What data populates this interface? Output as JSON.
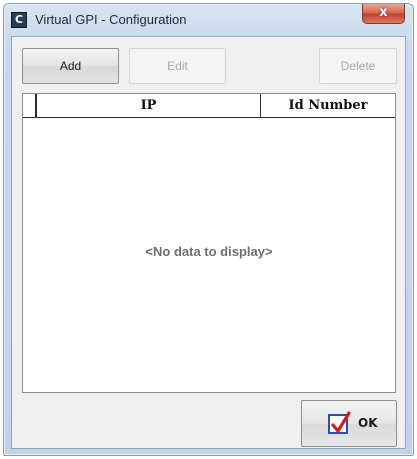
{
  "window": {
    "title": "Virtual GPI - Configuration",
    "app_icon_letter": "C",
    "close_glyph": "x"
  },
  "toolbar": {
    "add_label": "Add",
    "edit_label": "Edit",
    "delete_label": "Delete",
    "edit_enabled": false,
    "delete_enabled": false
  },
  "grid": {
    "columns": [
      "IP",
      "Id Number"
    ],
    "rows": [],
    "empty_message": "<No data to display>"
  },
  "footer": {
    "ok_label": "OK",
    "ok_icon": "checkbox-checked-icon"
  },
  "colors": {
    "close_button": "#c2402a",
    "ok_check": "#d01c1c",
    "ok_box": "#2b4fa3"
  }
}
